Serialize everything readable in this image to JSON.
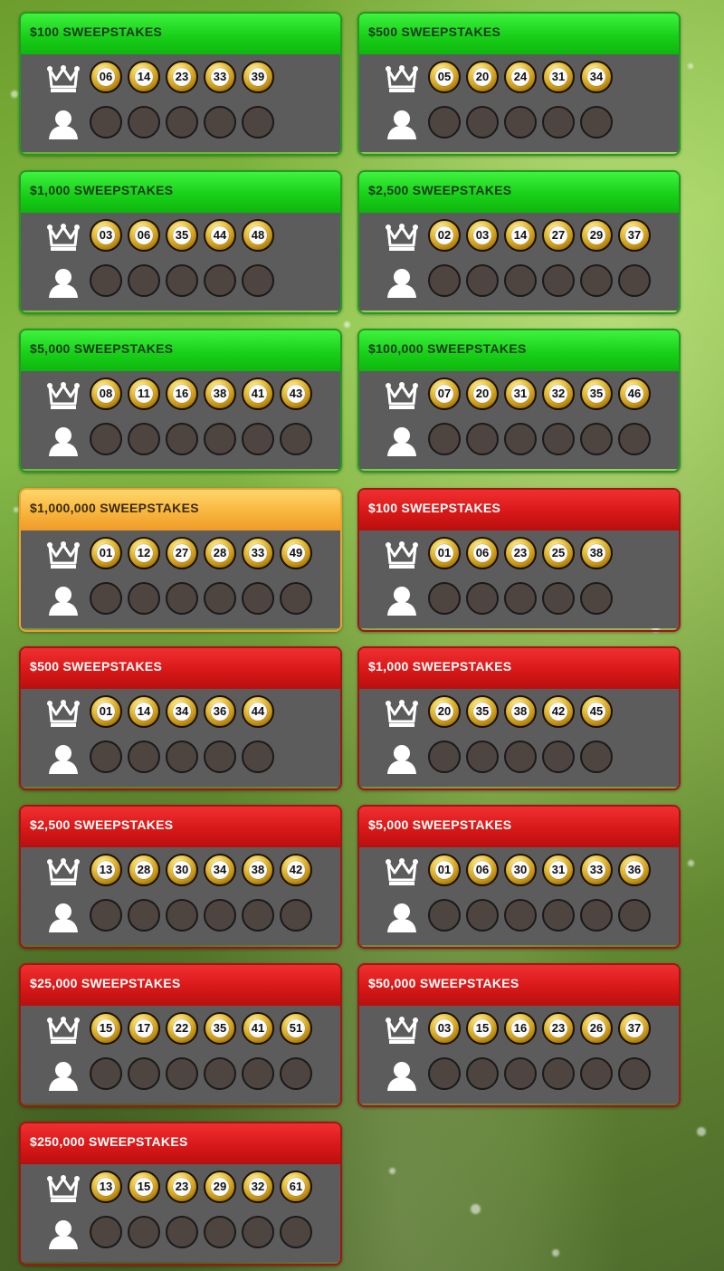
{
  "cards": [
    {
      "title": "$100 SWEEPSTAKES",
      "theme": "green",
      "numbers": [
        "06",
        "14",
        "23",
        "33",
        "39"
      ],
      "empty_slots": 5
    },
    {
      "title": "$500 SWEEPSTAKES",
      "theme": "green",
      "numbers": [
        "05",
        "20",
        "24",
        "31",
        "34"
      ],
      "empty_slots": 5
    },
    {
      "title": "$1,000 SWEEPSTAKES",
      "theme": "green",
      "numbers": [
        "03",
        "06",
        "35",
        "44",
        "48"
      ],
      "empty_slots": 5
    },
    {
      "title": "$2,500 SWEEPSTAKES",
      "theme": "green",
      "numbers": [
        "02",
        "03",
        "14",
        "27",
        "29",
        "37"
      ],
      "empty_slots": 6
    },
    {
      "title": "$5,000 SWEEPSTAKES",
      "theme": "green",
      "numbers": [
        "08",
        "11",
        "16",
        "38",
        "41",
        "43"
      ],
      "empty_slots": 6
    },
    {
      "title": "$100,000 SWEEPSTAKES",
      "theme": "green",
      "numbers": [
        "07",
        "20",
        "31",
        "32",
        "35",
        "46"
      ],
      "empty_slots": 6
    },
    {
      "title": "$1,000,000 SWEEPSTAKES",
      "theme": "gold",
      "numbers": [
        "01",
        "12",
        "27",
        "28",
        "33",
        "49"
      ],
      "empty_slots": 6
    },
    {
      "title": "$100 SWEEPSTAKES",
      "theme": "red",
      "numbers": [
        "01",
        "06",
        "23",
        "25",
        "38"
      ],
      "empty_slots": 5
    },
    {
      "title": "$500 SWEEPSTAKES",
      "theme": "red",
      "numbers": [
        "01",
        "14",
        "34",
        "36",
        "44"
      ],
      "empty_slots": 5
    },
    {
      "title": "$1,000 SWEEPSTAKES",
      "theme": "red",
      "numbers": [
        "20",
        "35",
        "38",
        "42",
        "45"
      ],
      "empty_slots": 5
    },
    {
      "title": "$2,500 SWEEPSTAKES",
      "theme": "red",
      "numbers": [
        "13",
        "28",
        "30",
        "34",
        "38",
        "42"
      ],
      "empty_slots": 6
    },
    {
      "title": "$5,000 SWEEPSTAKES",
      "theme": "red",
      "numbers": [
        "01",
        "06",
        "30",
        "31",
        "33",
        "36"
      ],
      "empty_slots": 6
    },
    {
      "title": "$25,000 SWEEPSTAKES",
      "theme": "red",
      "numbers": [
        "15",
        "17",
        "22",
        "35",
        "41",
        "51"
      ],
      "empty_slots": 6
    },
    {
      "title": "$50,000 SWEEPSTAKES",
      "theme": "red",
      "numbers": [
        "03",
        "15",
        "16",
        "23",
        "26",
        "37"
      ],
      "empty_slots": 6
    },
    {
      "title": "$250,000 SWEEPSTAKES",
      "theme": "red",
      "numbers": [
        "13",
        "15",
        "23",
        "29",
        "32",
        "61"
      ],
      "empty_slots": 6
    }
  ],
  "icons": {
    "winning_row": "crown-icon",
    "player_row": "user-icon"
  },
  "colors": {
    "green_header": "#19d019",
    "gold_header": "#f8b63e",
    "red_header": "#d81818",
    "panel": "#5c5c5c"
  }
}
